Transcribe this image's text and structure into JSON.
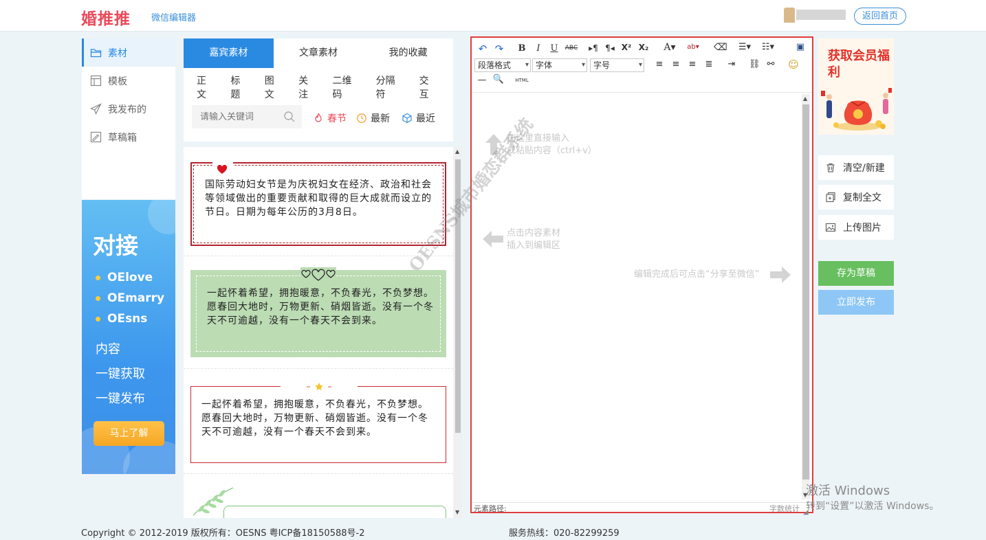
{
  "header": {
    "logo": "婚推推",
    "subtitle": "微信编辑器",
    "home_button": "返回首页"
  },
  "sidebar": {
    "items": [
      {
        "label": "素材",
        "icon": "folder-icon",
        "active": true
      },
      {
        "label": "模板",
        "icon": "template-icon",
        "active": false
      },
      {
        "label": "我发布的",
        "icon": "send-icon",
        "active": false
      },
      {
        "label": "草稿箱",
        "icon": "draft-icon",
        "active": false
      }
    ]
  },
  "promo": {
    "title": "对接",
    "brands": [
      "OElove",
      "OEmarry",
      "OEsns"
    ],
    "lines": [
      "内容",
      "一键获取",
      "一键发布"
    ],
    "button": "马上了解"
  },
  "materials": {
    "tabs": [
      "嘉宾素材",
      "文章素材",
      "我的收藏"
    ],
    "categories": [
      "正文",
      "标题",
      "图文",
      "关注",
      "二维码",
      "分隔符",
      "交互"
    ],
    "search_placeholder": "请输入关键词",
    "quick": [
      "春节",
      "最新",
      "最近"
    ],
    "cards": [
      "国际劳动妇女节是为庆祝妇女在经济、政治和社会等领域做出的重要贡献和取得的巨大成就而设立的节日。日期为每年公历的3月8日。",
      "一起怀着希望，拥抱暖意，不负春光，不负梦想。愿春回大地时，万物更新、硝烟皆逝。没有一个冬天不可逾越，没有一个春天不会到来。",
      "一起怀着希望，拥抱暖意，不负春光，不负梦想。愿春回大地时，万物更新、硝烟皆逝。没有一个冬天不可逾越，没有一个春天不会到来。"
    ]
  },
  "editor": {
    "selects": [
      "段落格式",
      "字体",
      "字号"
    ],
    "html_label": "HTML",
    "hints": {
      "input_line1": "在这里直接输入",
      "input_line2": "或粘贴内容（ctrl+v）",
      "click_line1": "点击内容素材",
      "click_line2": "插入到编辑区",
      "share": "编辑完成后可点击“分享至微信”"
    },
    "element_path": "元素路径:",
    "word_count": "字数统计"
  },
  "watermark": "OESNS城市婚恋群系统",
  "right_panel": {
    "benefit_title": "获取会员福利",
    "buttons": [
      "清空/新建",
      "复制全文",
      "上传图片"
    ],
    "draft": "存为草稿",
    "publish": "立即发布"
  },
  "activation": {
    "line1": "激活 Windows",
    "line2": "转到“设置”以激活 Windows。"
  },
  "footer": {
    "copyright": "Copyright © 2012-2019   版权所有：OESNS 粤ICP备18150588号-2",
    "hotline": "服务热线：020-82299259"
  },
  "colors": {
    "brand": "#e94a5a",
    "accent": "#2a8ae2",
    "highlight": "#e03c3c",
    "draft": "#67bf5f",
    "publish": "#8ec7f5"
  }
}
